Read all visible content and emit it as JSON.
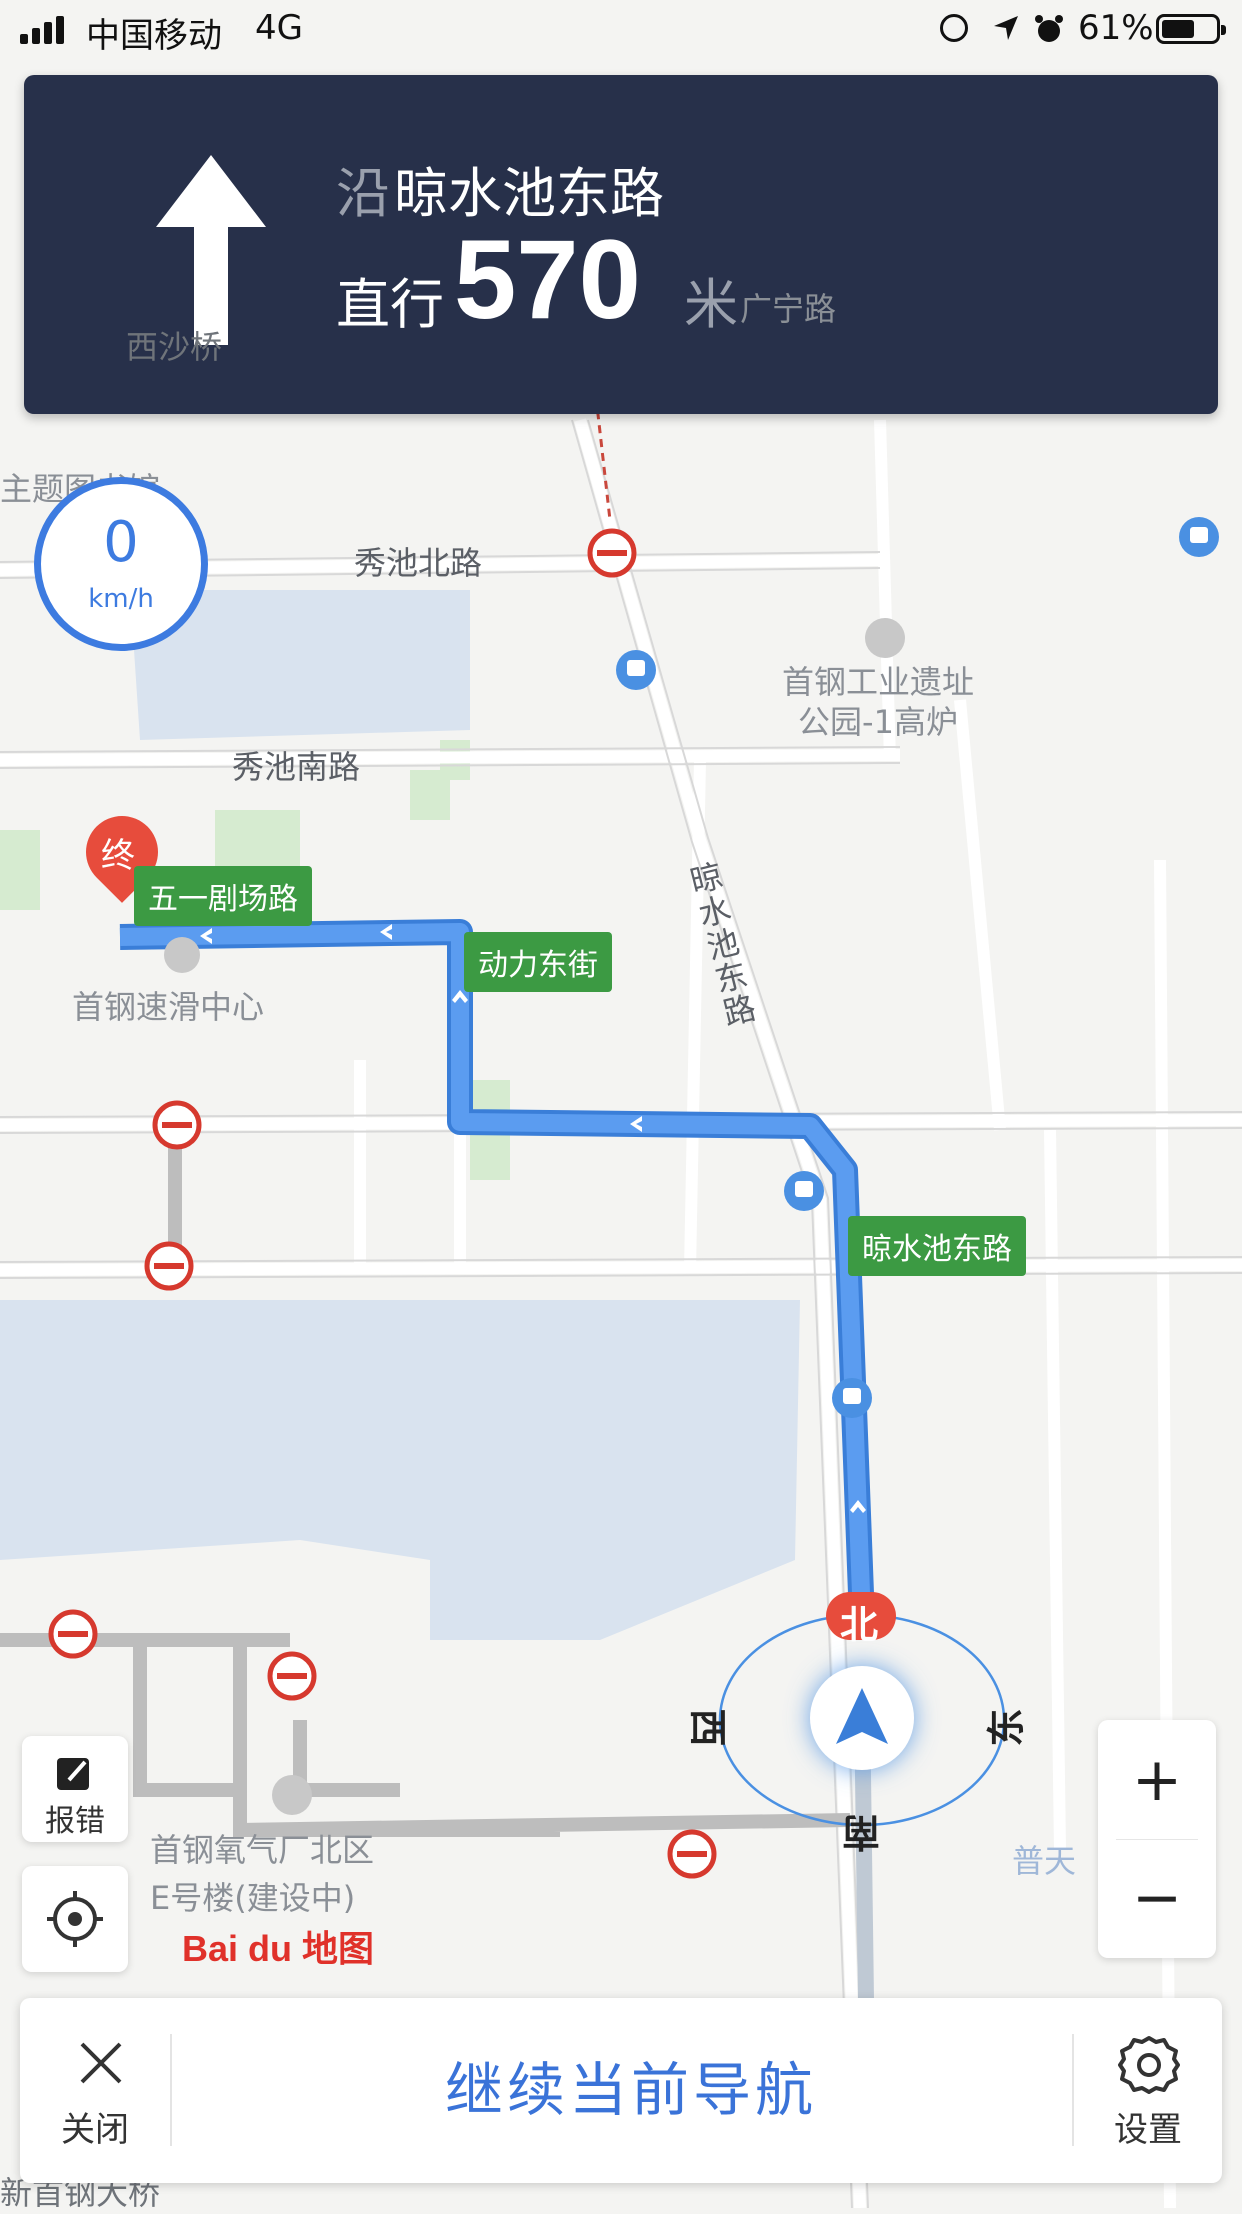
{
  "status_bar": {
    "carrier": "中国移动",
    "network": "4G",
    "battery_percent": "61%",
    "battery_level": 0.61,
    "icons": [
      "signal-icon",
      "orientation-lock-icon",
      "location-arrow-icon",
      "alarm-icon",
      "battery-icon"
    ]
  },
  "banner": {
    "prefix": "沿",
    "road": "晾水池东路",
    "action": "直行",
    "distance": "570",
    "unit": "米",
    "direction_icon": "straight-arrow-icon"
  },
  "speed": {
    "value": "0",
    "unit": "km/h"
  },
  "map": {
    "labels": {
      "guangning": "广宁路",
      "xishaqiao": "西沙桥",
      "library": "主题图书馆",
      "xiuchi_north": "秀池北路",
      "xiuchi_south": "秀池南路",
      "park": "首钢工业遗址\n公园-1高炉",
      "liangshuichi_vertical": "晾水池东路",
      "skating": "首钢速滑中心",
      "oxygen_plant": "首钢氧气厂北区\nE号楼(建设中)",
      "putian": "普天",
      "bridge": "新首钢大桥"
    },
    "route_tags": {
      "end_marker": "终",
      "wuyi": "五一剧场路",
      "dongli": "动力东街",
      "liangshuichi": "晾水池东路"
    },
    "compass": {
      "north": "北",
      "south": "南",
      "east": "东",
      "west": "西"
    },
    "route_color": "#5b9cf0",
    "logo_text": "Bai du 地图"
  },
  "controls": {
    "report": "报错",
    "zoom_in": "+",
    "zoom_out": "−"
  },
  "bottom_bar": {
    "close": "关闭",
    "continue": "继续当前导航",
    "settings": "设置"
  }
}
